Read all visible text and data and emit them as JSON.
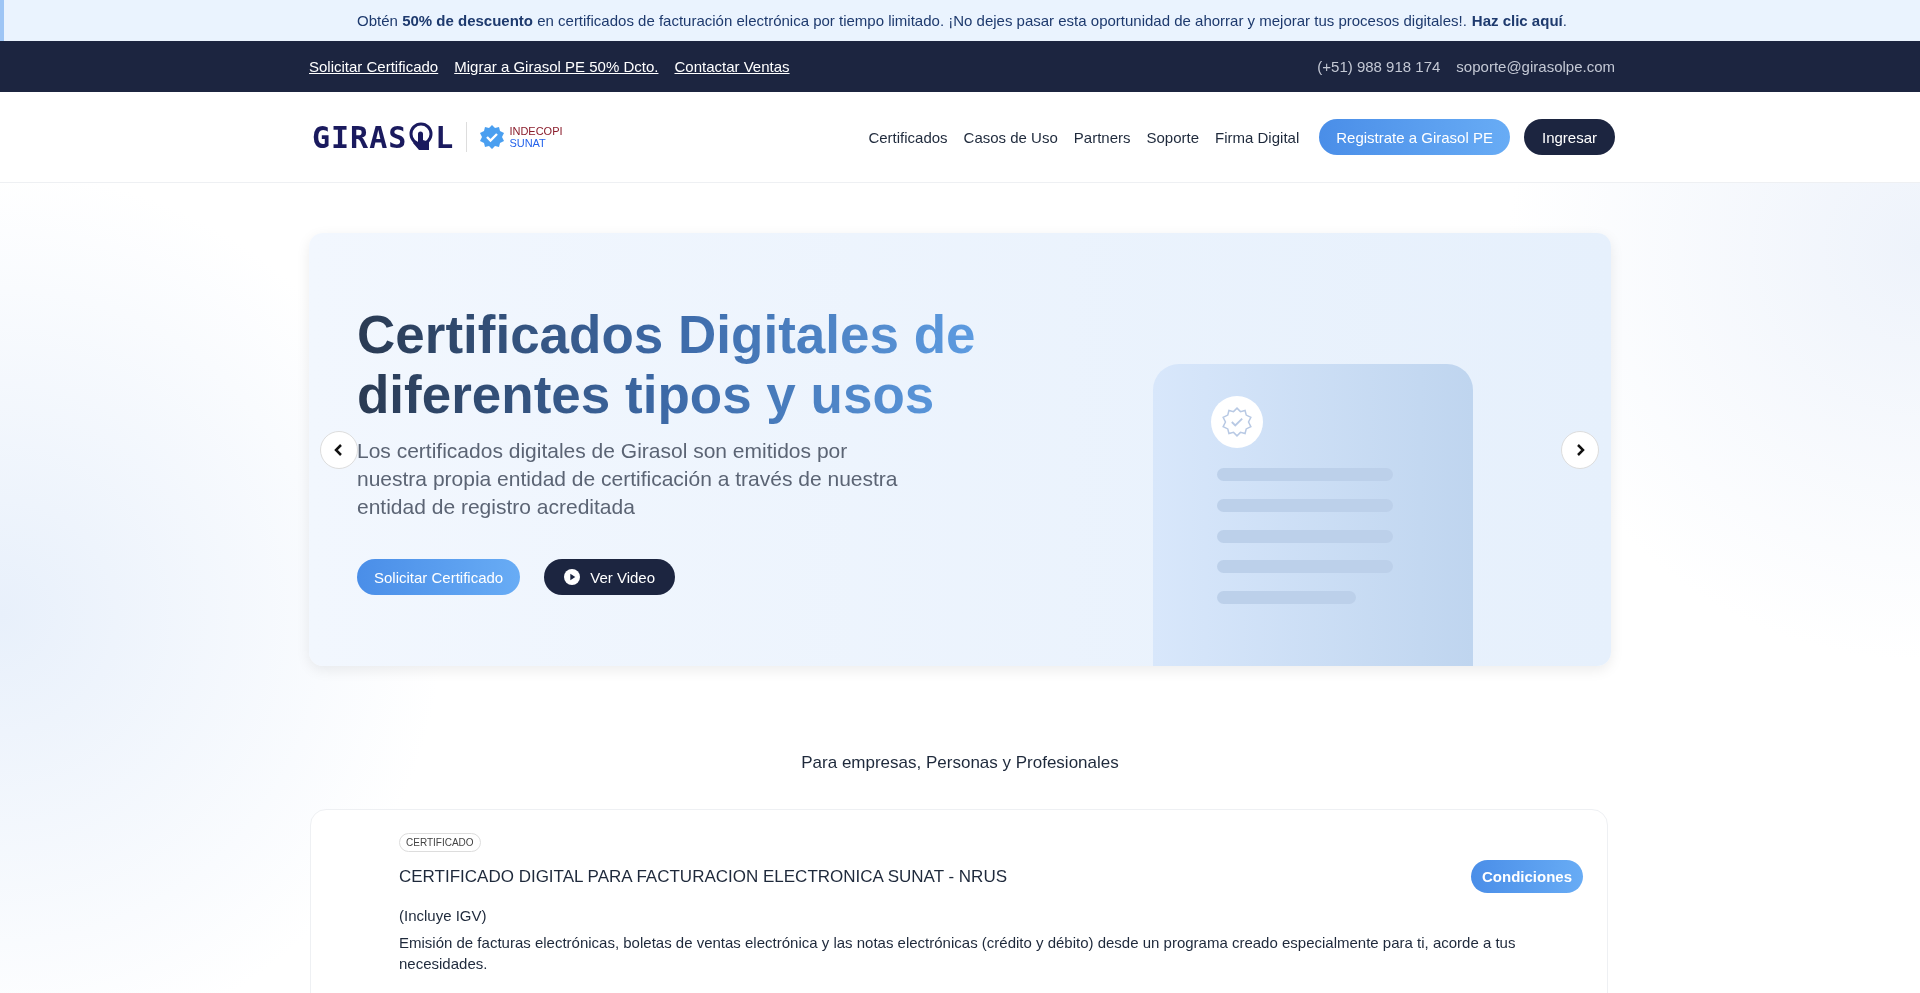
{
  "promo": {
    "text": "Obtén **50% de descuento** en certificados de facturación electrónica por tiempo limitado. ¡No dejes pasar esta oportunidad de ahorrar y mejorar tus procesos digitales!.",
    "link": "Haz clic aquí",
    "tail": "."
  },
  "topbar": {
    "links": [
      "Solicitar Certificado",
      "Migrar a Girasol PE 50% Dcto.",
      "Contactar Ventas"
    ],
    "phone": "(+51) 988 918 174",
    "email": "soporte@girasolpe.com"
  },
  "header": {
    "logo": [
      "GIRAS",
      "L"
    ],
    "badge": [
      "INDECOPI",
      "SUNAT"
    ],
    "nav": [
      "Certificados",
      "Casos de Uso",
      "Partners",
      "Soporte",
      "Firma Digital"
    ],
    "register": "Registrate a Girasol PE",
    "login": "Ingresar"
  },
  "hero": {
    "title": "Certificados Digitales de diferentes tipos y usos",
    "subtitle": "Los certificados digitales de Girasol son emitidos por nuestra propia entidad de certificación a través de nuestra entidad de registro acreditada",
    "primary": "Solicitar Certificado",
    "video": "Ver Video"
  },
  "section": {
    "label": "Para empresas, Personas y Profesionales"
  },
  "product": {
    "tag": "CERTIFICADO",
    "title": "CERTIFICADO DIGITAL PARA FACTURACION ELECTRONICA SUNAT - NRUS",
    "button": "Condiciones",
    "note": "(Incluye IGV)",
    "description": "Emisión de facturas electrónicas, boletas de ventas electrónica y las notas electrónicas (crédito y débito) desde un programa creado especialmente para ti, acorde a tus necesidades."
  }
}
